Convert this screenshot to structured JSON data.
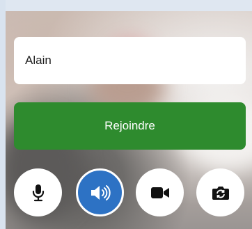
{
  "name_field": {
    "value": "Alain"
  },
  "join_button": {
    "label": "Rejoindre",
    "color": "#2e8b2e"
  },
  "controls": [
    {
      "icon": "microphone-icon",
      "active": false
    },
    {
      "icon": "speaker-icon",
      "active": true,
      "color": "#2d72c4"
    },
    {
      "icon": "video-camera-icon",
      "active": false
    },
    {
      "icon": "switch-camera-icon",
      "active": false
    }
  ]
}
